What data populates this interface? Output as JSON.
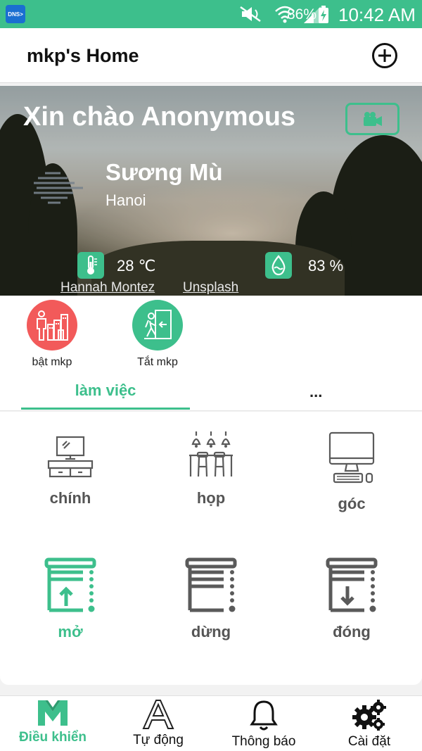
{
  "status_bar": {
    "dns_label": "DNS",
    "battery_pct": "86%",
    "time": "10:42 AM"
  },
  "header": {
    "title": "mkp's Home",
    "add_icon": "plus-circle-icon"
  },
  "hero": {
    "greeting": "Xin chào Anonymous",
    "camera_icon": "video-camera-icon",
    "weather": {
      "description": "Sương Mù",
      "city": "Hanoi",
      "temperature": "28 ℃",
      "humidity": "83 %"
    },
    "credits": {
      "author": "Hannah Montez",
      "source": "Unsplash"
    }
  },
  "scenes": [
    {
      "label": "bật mkp",
      "icon": "city-person-icon",
      "color": "#f25a5a"
    },
    {
      "label": "Tắt mkp",
      "icon": "exit-door-icon",
      "color": "#3dbf8c"
    }
  ],
  "tabs": {
    "active": "làm việc",
    "more": "..."
  },
  "devices": [
    {
      "label": "chính",
      "icon": "tv-desk-icon"
    },
    {
      "label": "họp",
      "icon": "pendant-lights-bar-icon"
    },
    {
      "label": "góc",
      "icon": "desktop-computer-icon"
    },
    {
      "label": "mở",
      "icon": "curtain-open-icon"
    },
    {
      "label": "dừng",
      "icon": "curtain-stop-icon"
    },
    {
      "label": "đóng",
      "icon": "curtain-close-icon"
    }
  ],
  "bottom_nav": [
    {
      "label": "Điều khiển",
      "icon": "m-logo-icon",
      "active": true
    },
    {
      "label": "Tự động",
      "icon": "letter-a-icon"
    },
    {
      "label": "Thông báo",
      "icon": "bell-icon"
    },
    {
      "label": "Cài đặt",
      "icon": "gears-icon"
    }
  ],
  "colors": {
    "accent": "#3dbf8c",
    "scene_on": "#f25a5a",
    "icon_gray": "#5a5a5a"
  }
}
